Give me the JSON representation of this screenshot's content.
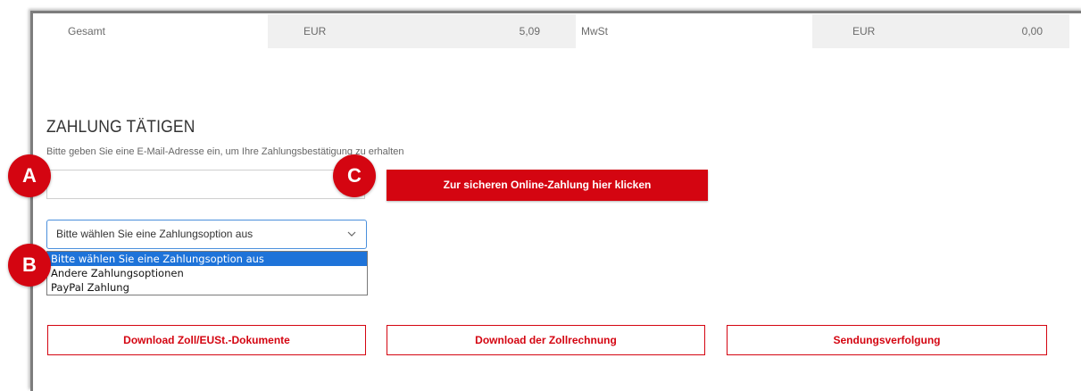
{
  "totals": {
    "gesamt_label": "Gesamt",
    "gesamt_currency": "EUR",
    "gesamt_value": "5,09",
    "mwst_label": "MwSt",
    "mwst_currency": "EUR",
    "mwst_value": "0,00"
  },
  "payment": {
    "title": "ZAHLUNG TÄTIGEN",
    "hint": "Bitte geben Sie eine E-Mail-Adresse ein, um Ihre Zahlungsbestätigung zu erhalten",
    "email_value": "",
    "pay_button": "Zur sicheren Online-Zahlung hier klicken",
    "select_value": "Bitte wählen Sie eine Zahlungsoption aus",
    "options": [
      "Bitte wählen Sie eine Zahlungsoption aus",
      "Andere Zahlungsoptionen",
      "PayPal Zahlung"
    ]
  },
  "actions": {
    "download_docs": "Download Zoll/EUSt.-Dokumente",
    "download_invoice": "Download der Zollrechnung",
    "tracking": "Sendungsverfolgung"
  },
  "badges": {
    "a": "A",
    "b": "B",
    "c": "C"
  },
  "colors": {
    "brand_red": "#d40511",
    "select_blue": "#1e73d9"
  }
}
